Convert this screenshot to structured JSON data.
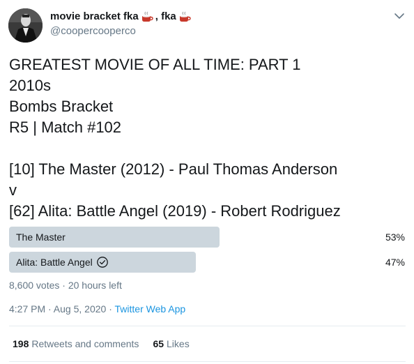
{
  "user": {
    "display_name": "movie bracket fka",
    "name_separator": ", fka",
    "handle": "@coopercooperco"
  },
  "icons": {
    "name_emoji_1": "hot-beverage-icon",
    "name_emoji_2": "hot-beverage-icon",
    "caret": "chevron-down-icon",
    "vote_check": "check-circle-icon"
  },
  "tweet": {
    "lines": [
      "GREATEST MOVIE OF ALL TIME: PART 1",
      "2010s",
      "Bombs Bracket",
      "R5 | Match #102",
      "",
      "[10] The Master (2012) - Paul Thomas Anderson",
      "v",
      "[62] Alita: Battle Angel (2019) - Robert Rodriguez"
    ]
  },
  "poll": {
    "options": [
      {
        "label": "The Master",
        "percent_text": "53%",
        "percent": 53,
        "voted": false
      },
      {
        "label": "Alita: Battle Angel",
        "percent_text": "47%",
        "percent": 47,
        "voted": true
      }
    ],
    "meta": "8,600 votes · 20 hours left"
  },
  "timestamp": {
    "text": "4:27 PM · Aug 5, 2020 · ",
    "app": "Twitter Web App"
  },
  "stats": {
    "retweets_count": "198",
    "retweets_label": "Retweets and comments",
    "likes_count": "65",
    "likes_label": "Likes"
  },
  "colors": {
    "poll_bar": "#ccd6dd",
    "secondary_text": "#657786",
    "link": "#1b95e0"
  }
}
